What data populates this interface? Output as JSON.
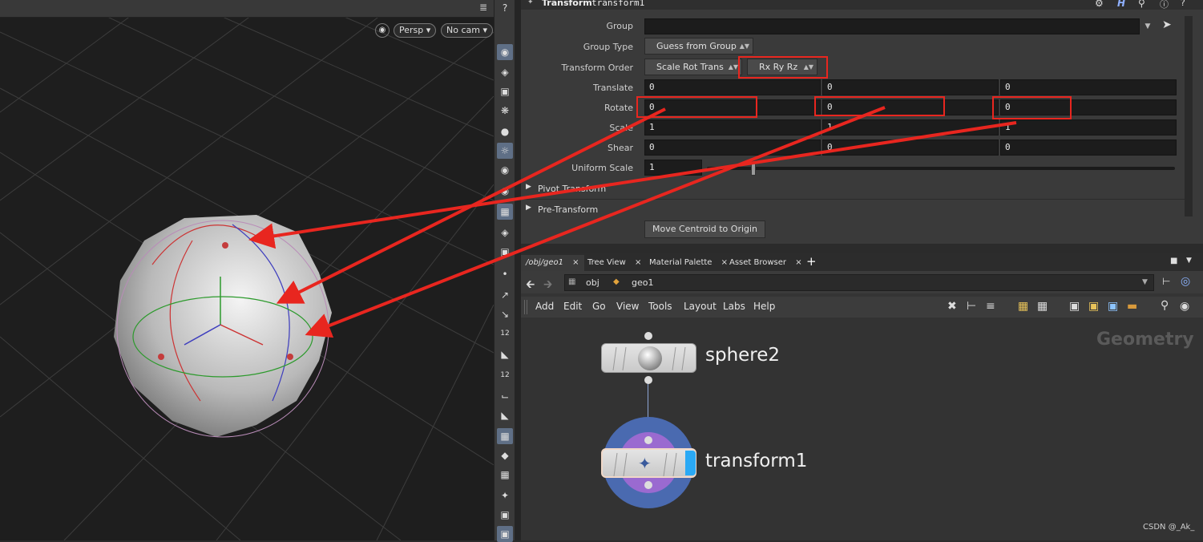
{
  "viewport": {
    "persp_label": "Persp",
    "cam_label": "No cam",
    "tools": [
      "12",
      "12"
    ]
  },
  "params": {
    "node_type": "Transform",
    "node_name": "transform1",
    "group_label": "Group",
    "group_value": "",
    "group_type_label": "Group Type",
    "group_type_value": "Guess from Group",
    "transform_order_label": "Transform Order",
    "transform_order_value": "Scale Rot Trans",
    "rotation_order_value": "Rx Ry Rz",
    "translate_label": "Translate",
    "translate": [
      "0",
      "0",
      "0"
    ],
    "rotate_label": "Rotate",
    "rotate": [
      "0",
      "0",
      "0"
    ],
    "scale_label": "Scale",
    "scale": [
      "1",
      "1",
      "1"
    ],
    "shear_label": "Shear",
    "shear": [
      "0",
      "0",
      "0"
    ],
    "uniform_scale_label": "Uniform Scale",
    "uniform_scale_value": "1",
    "uniform_scale_fraction": 0.1,
    "pivot_transform_label": "Pivot Transform",
    "pre_transform_label": "Pre-Transform",
    "move_centroid_label": "Move Centroid to Origin"
  },
  "network": {
    "tabs": [
      "/obj/geo1",
      "Tree View",
      "Material Palette",
      "Asset Browser"
    ],
    "path_obj": "obj",
    "path_geo": "geo1",
    "menu": [
      "Add",
      "Edit",
      "Go",
      "View",
      "Tools",
      "Layout",
      "Labs",
      "Help"
    ],
    "context_label": "Geometry",
    "nodes": [
      {
        "name": "sphere2"
      },
      {
        "name": "transform1"
      }
    ]
  },
  "watermark": "CSDN @_Ak_",
  "colors": {
    "annotation": "#e8261f",
    "selected_node_flag": "#2aa9f5",
    "transform_ring": "#4a6ab0",
    "transform_inner": "#9a6ad0"
  }
}
